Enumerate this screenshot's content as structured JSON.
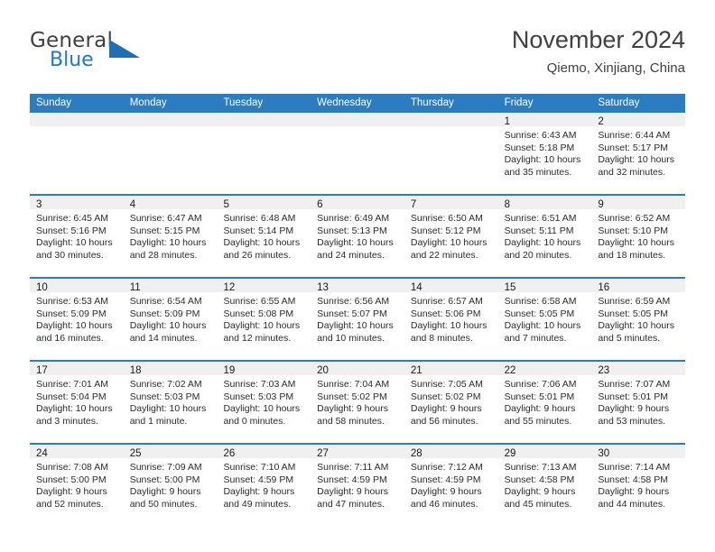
{
  "logo": {
    "word_top": "General",
    "word_bottom": "Blue",
    "triangle_color": "#1f6fb8",
    "blue_color": "#1f7ac4"
  },
  "header": {
    "title": "November 2024",
    "subtitle": "Qiemo, Xinjiang, China"
  },
  "colors": {
    "header_blue": "#2b7cc1",
    "day_band_gray": "#f0f0f0",
    "text": "#2b2b2b"
  },
  "weekdays": [
    "Sunday",
    "Monday",
    "Tuesday",
    "Wednesday",
    "Thursday",
    "Friday",
    "Saturday"
  ],
  "weeks": [
    [
      {
        "date": "",
        "sunrise": "",
        "sunset": "",
        "daylight_line1": "",
        "daylight_line2": ""
      },
      {
        "date": "",
        "sunrise": "",
        "sunset": "",
        "daylight_line1": "",
        "daylight_line2": ""
      },
      {
        "date": "",
        "sunrise": "",
        "sunset": "",
        "daylight_line1": "",
        "daylight_line2": ""
      },
      {
        "date": "",
        "sunrise": "",
        "sunset": "",
        "daylight_line1": "",
        "daylight_line2": ""
      },
      {
        "date": "",
        "sunrise": "",
        "sunset": "",
        "daylight_line1": "",
        "daylight_line2": ""
      },
      {
        "date": "1",
        "sunrise": "Sunrise: 6:43 AM",
        "sunset": "Sunset: 5:18 PM",
        "daylight_line1": "Daylight: 10 hours",
        "daylight_line2": "and 35 minutes."
      },
      {
        "date": "2",
        "sunrise": "Sunrise: 6:44 AM",
        "sunset": "Sunset: 5:17 PM",
        "daylight_line1": "Daylight: 10 hours",
        "daylight_line2": "and 32 minutes."
      }
    ],
    [
      {
        "date": "3",
        "sunrise": "Sunrise: 6:45 AM",
        "sunset": "Sunset: 5:16 PM",
        "daylight_line1": "Daylight: 10 hours",
        "daylight_line2": "and 30 minutes."
      },
      {
        "date": "4",
        "sunrise": "Sunrise: 6:47 AM",
        "sunset": "Sunset: 5:15 PM",
        "daylight_line1": "Daylight: 10 hours",
        "daylight_line2": "and 28 minutes."
      },
      {
        "date": "5",
        "sunrise": "Sunrise: 6:48 AM",
        "sunset": "Sunset: 5:14 PM",
        "daylight_line1": "Daylight: 10 hours",
        "daylight_line2": "and 26 minutes."
      },
      {
        "date": "6",
        "sunrise": "Sunrise: 6:49 AM",
        "sunset": "Sunset: 5:13 PM",
        "daylight_line1": "Daylight: 10 hours",
        "daylight_line2": "and 24 minutes."
      },
      {
        "date": "7",
        "sunrise": "Sunrise: 6:50 AM",
        "sunset": "Sunset: 5:12 PM",
        "daylight_line1": "Daylight: 10 hours",
        "daylight_line2": "and 22 minutes."
      },
      {
        "date": "8",
        "sunrise": "Sunrise: 6:51 AM",
        "sunset": "Sunset: 5:11 PM",
        "daylight_line1": "Daylight: 10 hours",
        "daylight_line2": "and 20 minutes."
      },
      {
        "date": "9",
        "sunrise": "Sunrise: 6:52 AM",
        "sunset": "Sunset: 5:10 PM",
        "daylight_line1": "Daylight: 10 hours",
        "daylight_line2": "and 18 minutes."
      }
    ],
    [
      {
        "date": "10",
        "sunrise": "Sunrise: 6:53 AM",
        "sunset": "Sunset: 5:09 PM",
        "daylight_line1": "Daylight: 10 hours",
        "daylight_line2": "and 16 minutes."
      },
      {
        "date": "11",
        "sunrise": "Sunrise: 6:54 AM",
        "sunset": "Sunset: 5:09 PM",
        "daylight_line1": "Daylight: 10 hours",
        "daylight_line2": "and 14 minutes."
      },
      {
        "date": "12",
        "sunrise": "Sunrise: 6:55 AM",
        "sunset": "Sunset: 5:08 PM",
        "daylight_line1": "Daylight: 10 hours",
        "daylight_line2": "and 12 minutes."
      },
      {
        "date": "13",
        "sunrise": "Sunrise: 6:56 AM",
        "sunset": "Sunset: 5:07 PM",
        "daylight_line1": "Daylight: 10 hours",
        "daylight_line2": "and 10 minutes."
      },
      {
        "date": "14",
        "sunrise": "Sunrise: 6:57 AM",
        "sunset": "Sunset: 5:06 PM",
        "daylight_line1": "Daylight: 10 hours",
        "daylight_line2": "and 8 minutes."
      },
      {
        "date": "15",
        "sunrise": "Sunrise: 6:58 AM",
        "sunset": "Sunset: 5:05 PM",
        "daylight_line1": "Daylight: 10 hours",
        "daylight_line2": "and 7 minutes."
      },
      {
        "date": "16",
        "sunrise": "Sunrise: 6:59 AM",
        "sunset": "Sunset: 5:05 PM",
        "daylight_line1": "Daylight: 10 hours",
        "daylight_line2": "and 5 minutes."
      }
    ],
    [
      {
        "date": "17",
        "sunrise": "Sunrise: 7:01 AM",
        "sunset": "Sunset: 5:04 PM",
        "daylight_line1": "Daylight: 10 hours",
        "daylight_line2": "and 3 minutes."
      },
      {
        "date": "18",
        "sunrise": "Sunrise: 7:02 AM",
        "sunset": "Sunset: 5:03 PM",
        "daylight_line1": "Daylight: 10 hours",
        "daylight_line2": "and 1 minute."
      },
      {
        "date": "19",
        "sunrise": "Sunrise: 7:03 AM",
        "sunset": "Sunset: 5:03 PM",
        "daylight_line1": "Daylight: 10 hours",
        "daylight_line2": "and 0 minutes."
      },
      {
        "date": "20",
        "sunrise": "Sunrise: 7:04 AM",
        "sunset": "Sunset: 5:02 PM",
        "daylight_line1": "Daylight: 9 hours",
        "daylight_line2": "and 58 minutes."
      },
      {
        "date": "21",
        "sunrise": "Sunrise: 7:05 AM",
        "sunset": "Sunset: 5:02 PM",
        "daylight_line1": "Daylight: 9 hours",
        "daylight_line2": "and 56 minutes."
      },
      {
        "date": "22",
        "sunrise": "Sunrise: 7:06 AM",
        "sunset": "Sunset: 5:01 PM",
        "daylight_line1": "Daylight: 9 hours",
        "daylight_line2": "and 55 minutes."
      },
      {
        "date": "23",
        "sunrise": "Sunrise: 7:07 AM",
        "sunset": "Sunset: 5:01 PM",
        "daylight_line1": "Daylight: 9 hours",
        "daylight_line2": "and 53 minutes."
      }
    ],
    [
      {
        "date": "24",
        "sunrise": "Sunrise: 7:08 AM",
        "sunset": "Sunset: 5:00 PM",
        "daylight_line1": "Daylight: 9 hours",
        "daylight_line2": "and 52 minutes."
      },
      {
        "date": "25",
        "sunrise": "Sunrise: 7:09 AM",
        "sunset": "Sunset: 5:00 PM",
        "daylight_line1": "Daylight: 9 hours",
        "daylight_line2": "and 50 minutes."
      },
      {
        "date": "26",
        "sunrise": "Sunrise: 7:10 AM",
        "sunset": "Sunset: 4:59 PM",
        "daylight_line1": "Daylight: 9 hours",
        "daylight_line2": "and 49 minutes."
      },
      {
        "date": "27",
        "sunrise": "Sunrise: 7:11 AM",
        "sunset": "Sunset: 4:59 PM",
        "daylight_line1": "Daylight: 9 hours",
        "daylight_line2": "and 47 minutes."
      },
      {
        "date": "28",
        "sunrise": "Sunrise: 7:12 AM",
        "sunset": "Sunset: 4:59 PM",
        "daylight_line1": "Daylight: 9 hours",
        "daylight_line2": "and 46 minutes."
      },
      {
        "date": "29",
        "sunrise": "Sunrise: 7:13 AM",
        "sunset": "Sunset: 4:58 PM",
        "daylight_line1": "Daylight: 9 hours",
        "daylight_line2": "and 45 minutes."
      },
      {
        "date": "30",
        "sunrise": "Sunrise: 7:14 AM",
        "sunset": "Sunset: 4:58 PM",
        "daylight_line1": "Daylight: 9 hours",
        "daylight_line2": "and 44 minutes."
      }
    ]
  ]
}
